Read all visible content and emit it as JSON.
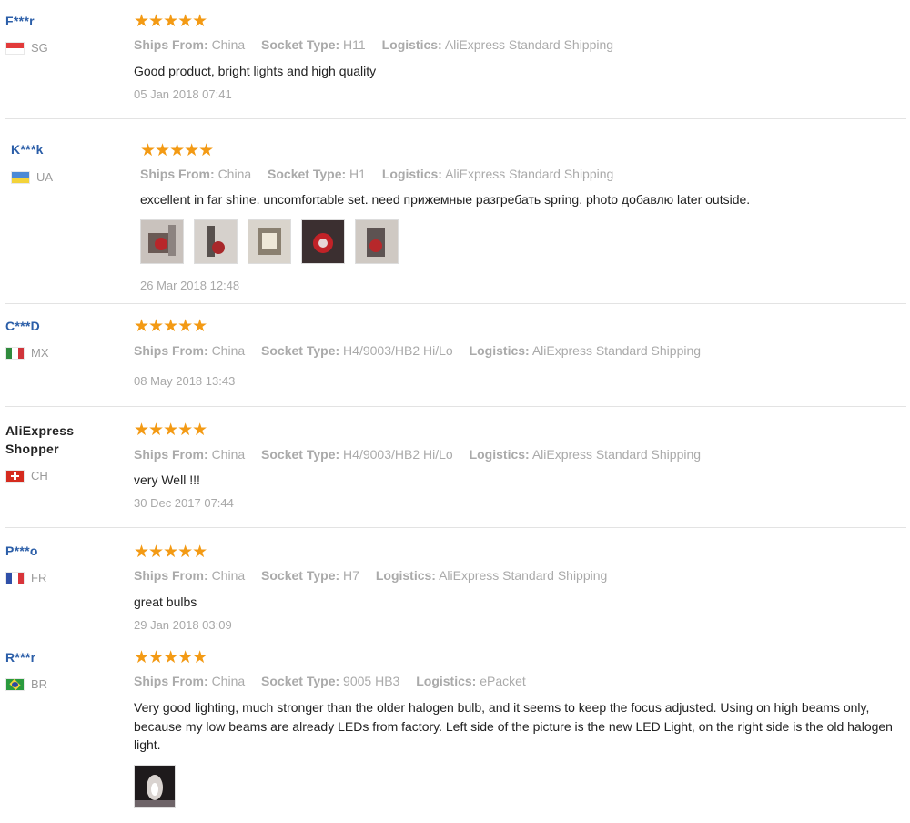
{
  "reviews": [
    {
      "user": "F***r",
      "country": "SG",
      "stars": "★★★★★",
      "ships_label": "Ships From:",
      "ships_value": "China",
      "socket_label": "Socket Type:",
      "socket_value": "H11",
      "logistics_label": "Logistics:",
      "logistics_value": "AliExpress Standard Shipping",
      "text": "Good product, bright lights and high quality",
      "date": "05 Jan 2018 07:41"
    },
    {
      "user": "K***k",
      "country": "UA",
      "stars": "★★★★★",
      "ships_label": "Ships From:",
      "ships_value": "China",
      "socket_label": "Socket Type:",
      "socket_value": "H1",
      "logistics_label": "Logistics:",
      "logistics_value": "AliExpress Standard Shipping",
      "text": "excellent in far shine. uncomfortable set. need прижемные разгребать spring. photo добавлю later outside.",
      "date": "26 Mar 2018 12:48"
    },
    {
      "user": "C***D",
      "country": "MX",
      "stars": "★★★★★",
      "ships_label": "Ships From:",
      "ships_value": "China",
      "socket_label": "Socket Type:",
      "socket_value": "H4/9003/HB2 Hi/Lo",
      "logistics_label": "Logistics:",
      "logistics_value": "AliExpress Standard Shipping",
      "date": "08 May 2018 13:43"
    },
    {
      "user": "AliExpress Shopper",
      "country": "CH",
      "stars": "★★★★★",
      "ships_label": "Ships From:",
      "ships_value": "China",
      "socket_label": "Socket Type:",
      "socket_value": "H4/9003/HB2 Hi/Lo",
      "logistics_label": "Logistics:",
      "logistics_value": "AliExpress Standard Shipping",
      "text": "very Well !!!",
      "date": "30 Dec 2017 07:44"
    },
    {
      "user": "P***o",
      "country": "FR",
      "stars": "★★★★★",
      "ships_label": "Ships From:",
      "ships_value": "China",
      "socket_label": "Socket Type:",
      "socket_value": "H7",
      "logistics_label": "Logistics:",
      "logistics_value": "AliExpress Standard Shipping",
      "text": "great bulbs",
      "date": "29 Jan 2018 03:09"
    },
    {
      "user": "R***r",
      "country": "BR",
      "stars": "★★★★★",
      "ships_label": "Ships From:",
      "ships_value": "China",
      "socket_label": "Socket Type:",
      "socket_value": "9005 HB3",
      "logistics_label": "Logistics:",
      "logistics_value": "ePacket",
      "text": "Very good lighting, much stronger than the older halogen bulb, and it seems to keep the focus adjusted. Using on high beams only, because my low beams are already LEDs from factory. Left side of the picture is the new LED Light, on the right side is the old halogen light."
    }
  ],
  "colors": {
    "username": "#2b5ea8",
    "stars": "#f39a14",
    "meta": "#aaaaaa"
  }
}
